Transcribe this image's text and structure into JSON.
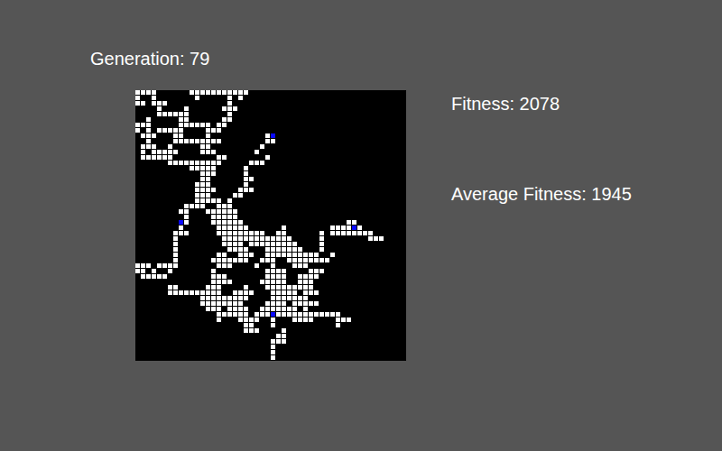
{
  "generation": {
    "label": "Generation: 79"
  },
  "stats": [
    {
      "label": "Fitness: 2078"
    },
    {
      "label": "Average Fitness: 1945"
    }
  ],
  "board": {
    "cell_colors": {
      "#": "#ffffff",
      "B": "#0a0aff"
    },
    "rows": [
      "####......###########",
      "#..#.......#.....#.#",
      "##.###...........#",
      "....#....#......###",
      "....######.......#",
      "..#.....##......##",
      "###.....######.##",
      "#.#.#####....###",
      ".###...##....#..........#B",
      "..#....#########........##",
      ".###..#.....##.........#",
      ".#.#####....###.......#",
      ".######........##.......#",
      "......##########.....###",
      "..........#####.....#",
      "............###.....#",
      "............##......##",
      "...........###......#",
      "...........####....###",
      "...........###....##",
      "...........#####.#",
      ".........####..###",
      "........##...######",
      ".........#....#####",
      "........B#....######...................##",
      "........#......######......#........####B#",
      ".......###.....#########..##......#.########",
      ".......#........#############.....#........###",
      ".......#........####.#########....#",
      ".......#.........####...#######...#",
      ".......#.......##..###..##########..#",
      ".......#......#######..###..########",
      "###.####.......###....#..#...###",
      "##.#..#.......#.........####....###",
      ".#####........###.......####..####",
      "..............####.....#####..###",
      "......##.....###....#...#########",
      "......##########..####...#####.###",
      "............#########....#######",
      "............########....####.#####",
      ".............###.####..#######.#",
      "...............######.###B############",
      "...............#...####..#...####....###",
      "....................##...#...........#",
      "....................###....#",
      "..........................##",
      ".........................###",
      ".........................#",
      ".........................#",
      ".........................#"
    ]
  }
}
